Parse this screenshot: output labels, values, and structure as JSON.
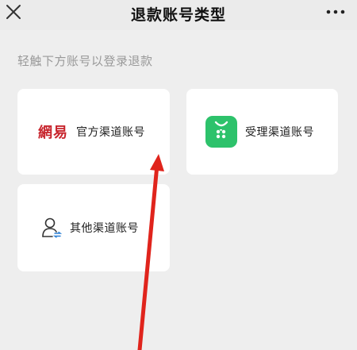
{
  "header": {
    "title": "退款账号类型",
    "close_icon": "close-icon",
    "more_icon": "more-dots-icon"
  },
  "hint": "轻触下方账号以登录退款",
  "cards": [
    {
      "label": "官方渠道账号",
      "logo_text": "網易",
      "icon": "netease-logo"
    },
    {
      "label": "受理渠道账号",
      "icon": "green-app-icon"
    },
    {
      "label": "其他渠道账号",
      "icon": "person-switch-icon"
    }
  ],
  "colors": {
    "accent_green": "#2dc26b",
    "annotation_red": "#e0241c",
    "logo_red": "#c8262e"
  }
}
